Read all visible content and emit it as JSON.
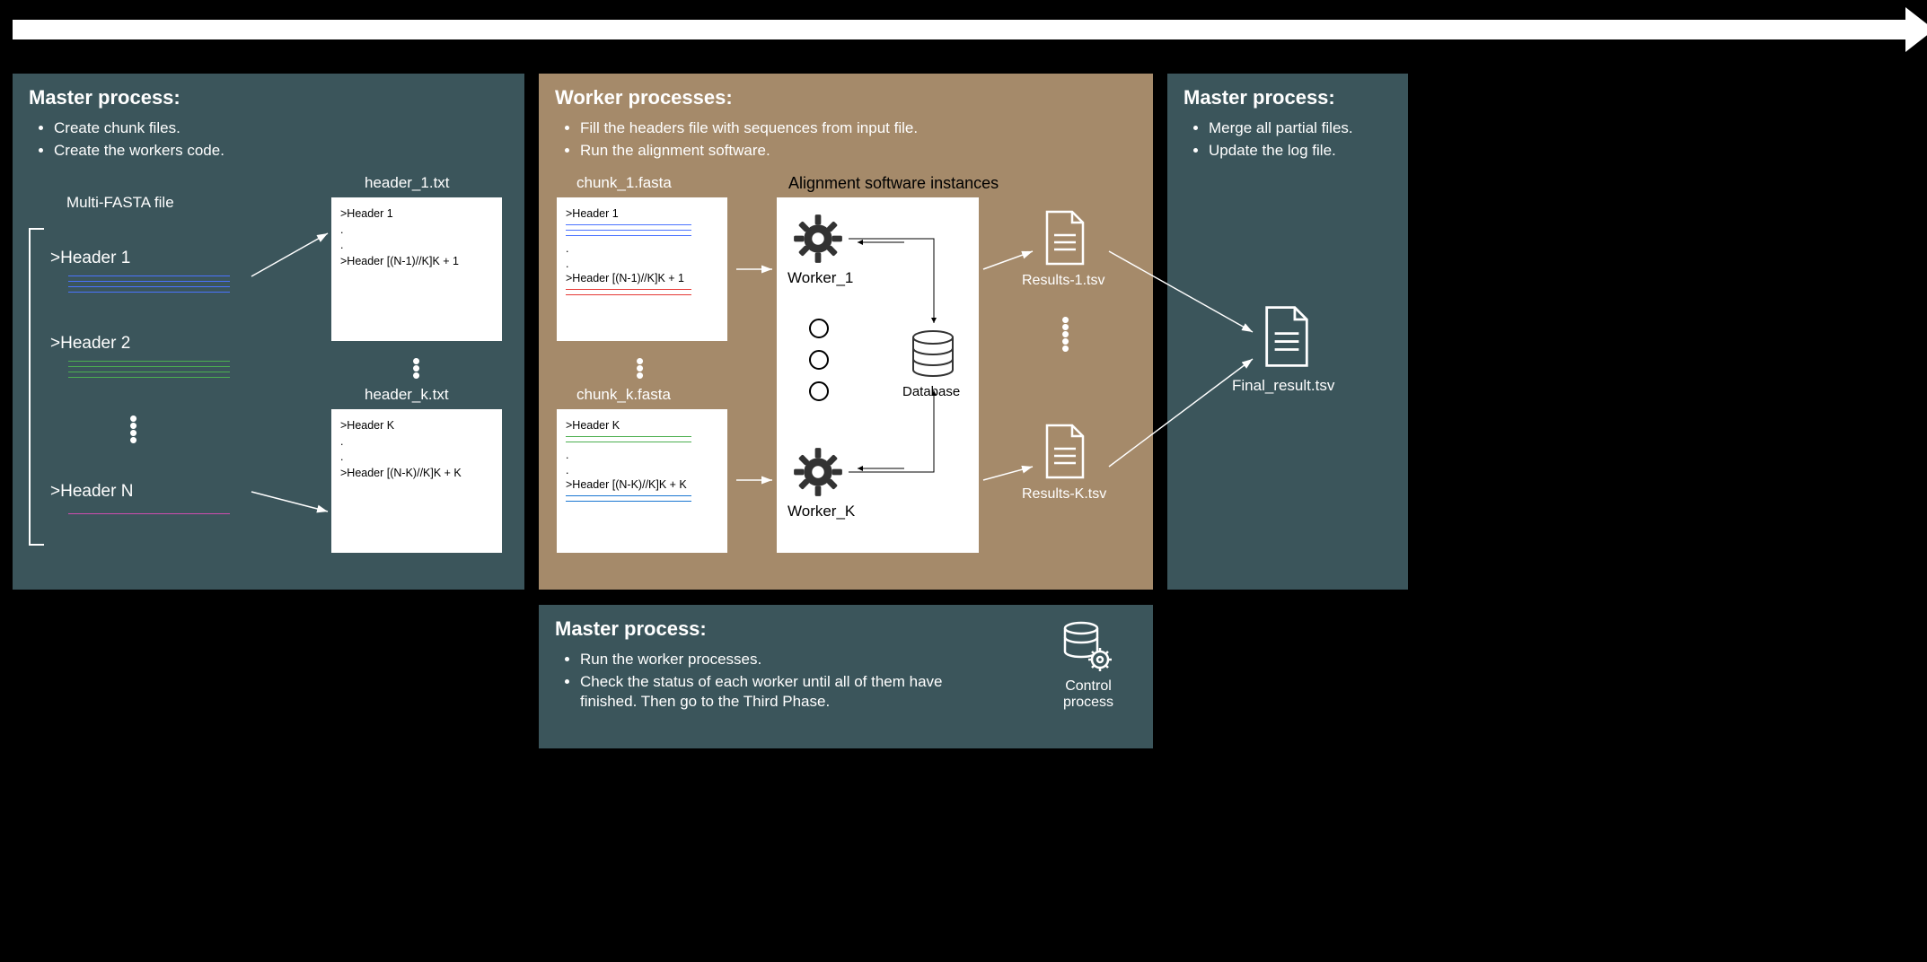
{
  "arrow_label": "",
  "panel_master1": {
    "title": "Master process:",
    "items": [
      "Create chunk files.",
      "Create the workers code."
    ]
  },
  "fasta_title": "Multi-FASTA file",
  "fasta_headers": {
    "h1": ">Header 1",
    "h2": ">Header 2",
    "hn": ">Header N"
  },
  "header1_title": "header_1.txt",
  "header1_lines": {
    "l1": ">Header 1",
    "d1": ".",
    "d2": ".",
    "l2": ">Header [(N-1)//K]K + 1"
  },
  "headerk_title": "header_k.txt",
  "headerk_lines": {
    "l1": ">Header K",
    "d1": ".",
    "d2": ".",
    "l2": ">Header [(N-K)//K]K + K"
  },
  "panel_worker": {
    "title": "Worker processes:",
    "items": [
      "Fill the headers file with sequences from input file.",
      "Run the alignment software."
    ]
  },
  "chunk1_title": "chunk_1.fasta",
  "chunk1_lines": {
    "l1": ">Header 1",
    "d1": ".",
    "d2": ".",
    "l2": ">Header [(N-1)//K]K + 1"
  },
  "chunkk_title": "chunk_k.fasta",
  "chunkk_lines": {
    "l1": ">Header K",
    "d1": ".",
    "d2": ".",
    "l2": ">Header [(N-K)//K]K + K"
  },
  "align_title": "Alignment software instances",
  "worker1_label": "Worker_1",
  "workerk_label": "Worker_K",
  "database_label": "Database",
  "results1_label": "Results-1.tsv",
  "resultsk_label": "Results-K.tsv",
  "panel_master2": {
    "title": "Master process:",
    "items": [
      "Run the worker processes.",
      "Check the status of each worker until all of them have finished. Then go to the Third Phase."
    ]
  },
  "control_label": "Control process",
  "panel_master3": {
    "title": "Master process:",
    "items": [
      "Merge all partial files.",
      "Update the log file."
    ]
  },
  "final_label": "Final_result.tsv"
}
